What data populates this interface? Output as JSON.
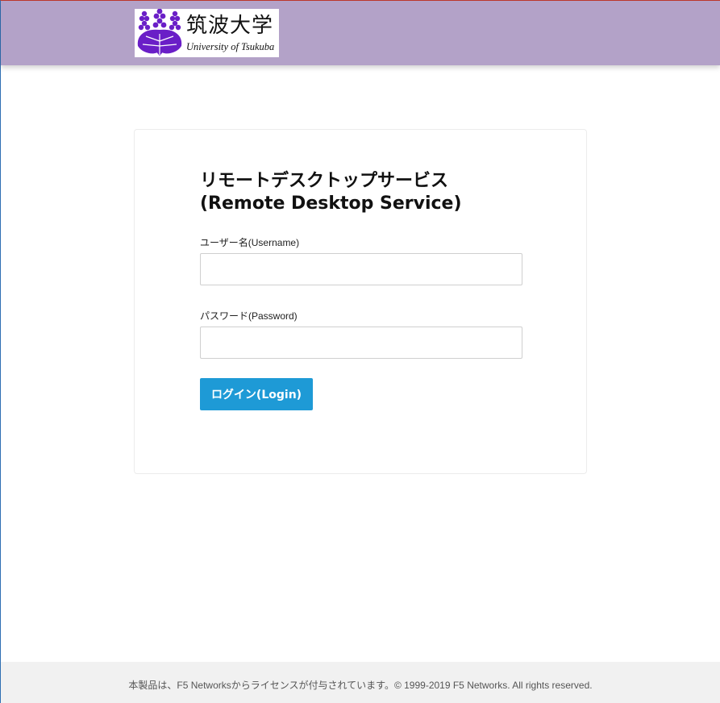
{
  "header": {
    "logo": {
      "name_jp": "筑波大学",
      "name_en": "University of Tsukuba",
      "emblem_color": "#6a1fc7"
    },
    "background_color": "#b3a2c8"
  },
  "login_form": {
    "title_line1": "リモートデスクトップサービス",
    "title_line2": "(Remote Desktop Service)",
    "username": {
      "label": "ユーザー名(Username)",
      "value": ""
    },
    "password": {
      "label": "パスワード(Password)",
      "value": ""
    },
    "submit_label": "ログイン(Login)",
    "submit_color": "#1e9ad6"
  },
  "footer": {
    "text": "本製品は、F5 Networksからライセンスが付与されています。© 1999-2019 F5 Networks. All rights reserved."
  }
}
